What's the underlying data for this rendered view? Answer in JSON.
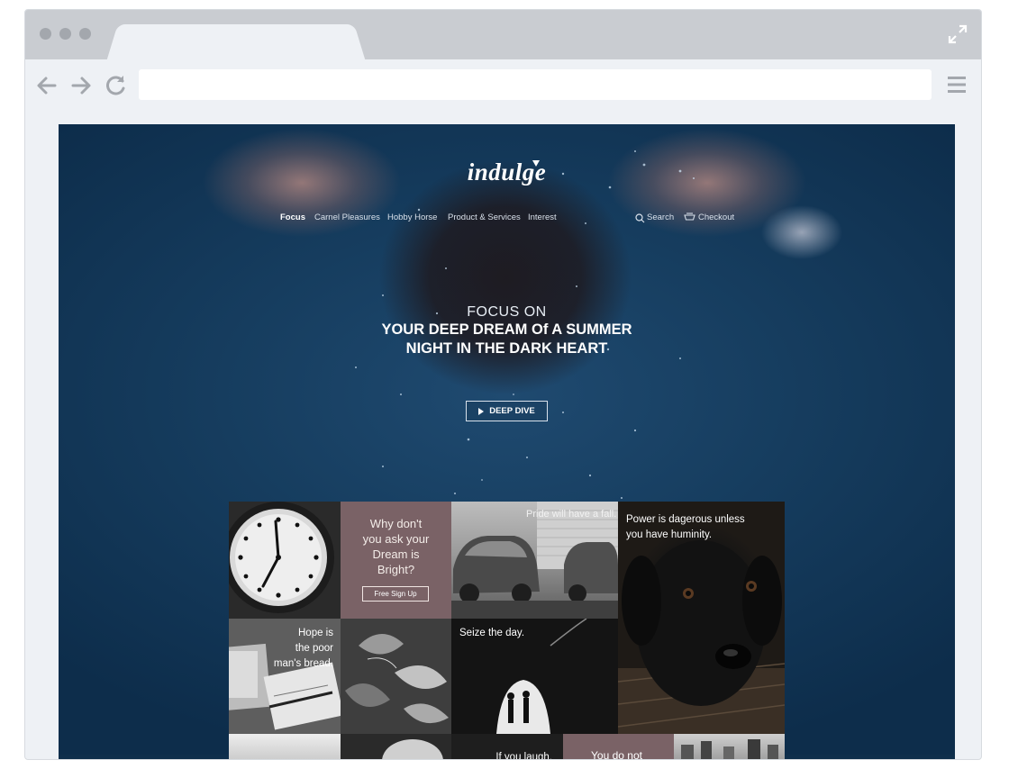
{
  "site": {
    "logo_text": "indulge",
    "nav": {
      "items": [
        {
          "label": "Focus",
          "active": true
        },
        {
          "label": "Carnel Pleasures"
        },
        {
          "label": "Hobby Horse"
        },
        {
          "label": "Product & Services"
        },
        {
          "label": "Interest"
        }
      ],
      "search_label": "Search",
      "checkout_label": "Checkout"
    },
    "hero": {
      "pre": "FOCUS ON",
      "line1": "YOUR DEEP DREAM Of A SUMMER",
      "line2": "NIGHT IN THE DARK HEART",
      "cta_label": "DEEP DIVE"
    },
    "grid": {
      "why_line1": "Why don't",
      "why_line2": "you ask your",
      "why_line3": "Dream is",
      "why_line4": "Bright?",
      "signup_label": "Free Sign Up",
      "pride_caption": "Pride will have a fall.",
      "power_line1": "Power is dagerous unless",
      "power_line2": "you have huminity.",
      "hope_line1": "Hope is",
      "hope_line2": "the poor",
      "hope_line3": "man's bread.",
      "seize_caption": "Seize the day.",
      "laugh_caption": "If you laugh,",
      "donot_caption": "You do not"
    }
  },
  "colors": {
    "hero_blue": "#163d5f",
    "mauve": "#7a6266"
  }
}
